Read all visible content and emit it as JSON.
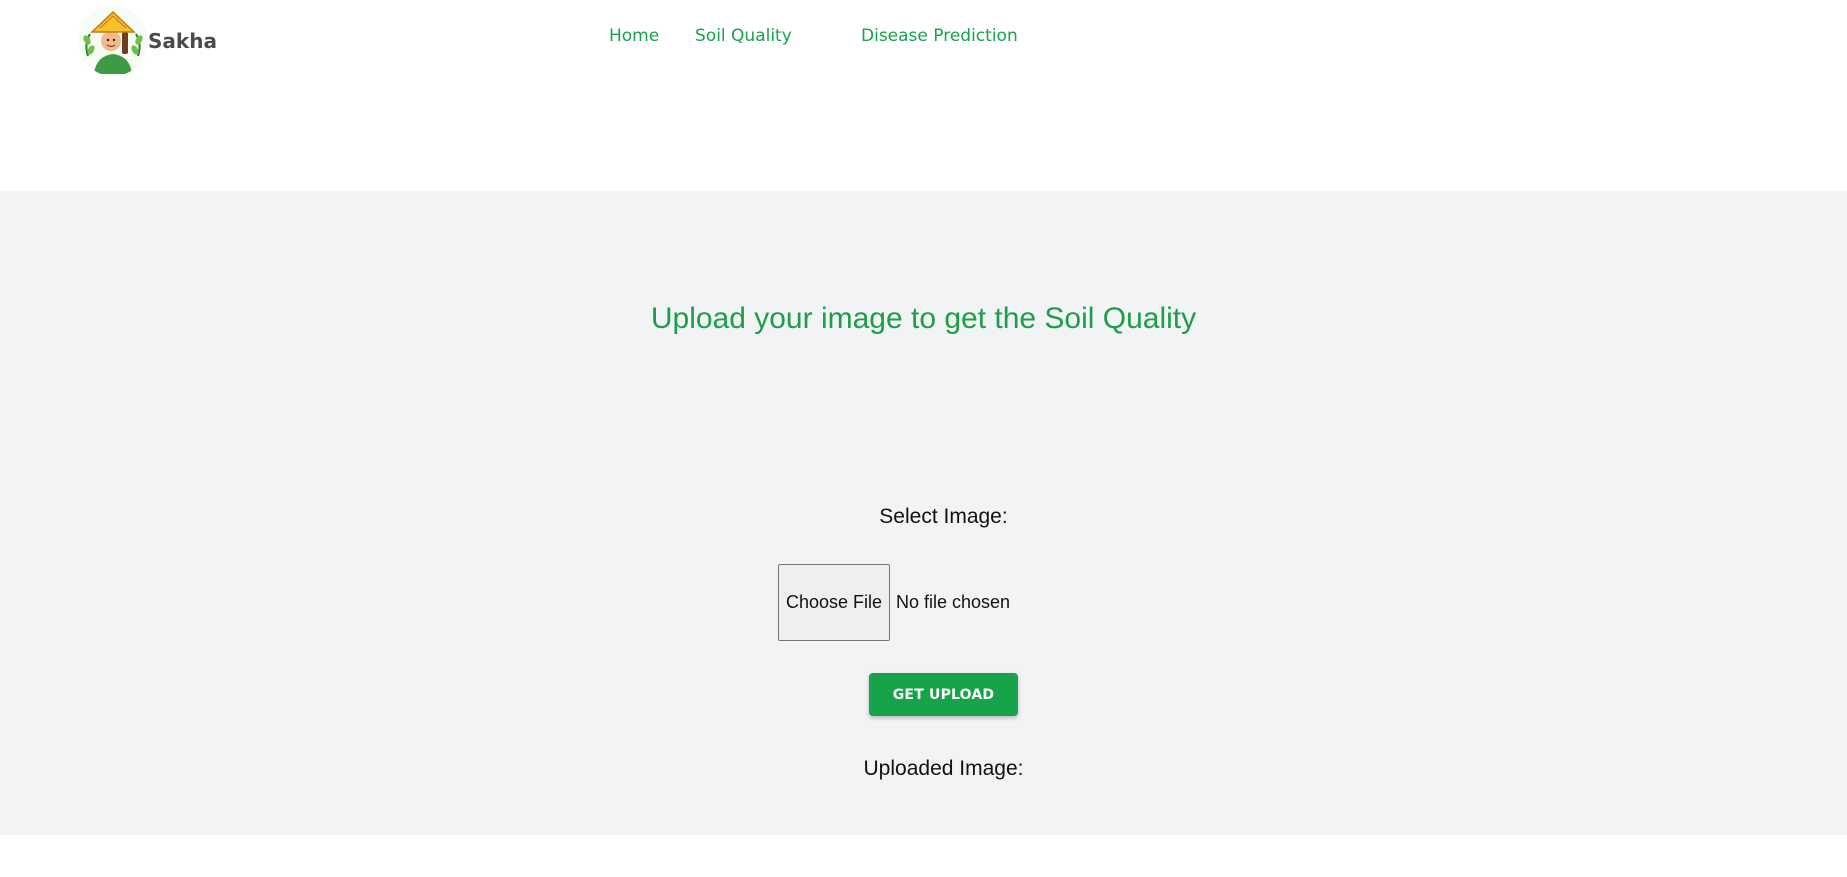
{
  "header": {
    "brand_name": "Sakha",
    "nav": {
      "home": "Home",
      "soil_quality": "Soil Quality",
      "disease_prediction": "Disease Prediction"
    }
  },
  "main": {
    "title": "Upload your image to get the Soil Quality",
    "select_label": "Select Image:",
    "file_input": {
      "button_label": "Choose File",
      "status": "No file chosen"
    },
    "upload_button": "GET UPLOAD",
    "uploaded_label": "Uploaded Image:"
  },
  "colors": {
    "accent": "#17a34a",
    "title": "#1e9e49",
    "section_bg": "#f2f3f5"
  },
  "icons": {
    "logo": "farmer-logo-icon"
  }
}
